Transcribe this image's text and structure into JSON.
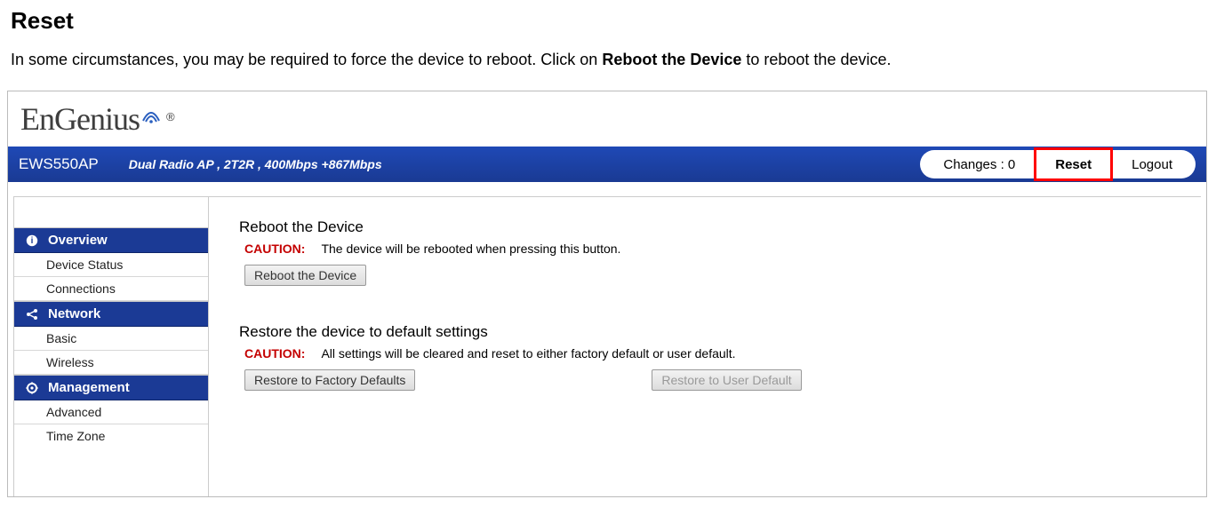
{
  "page": {
    "title": "Reset",
    "description_pre": "In some circumstances, you may be required to force the device to reboot. Click on ",
    "description_bold": "Reboot the Device",
    "description_post": " to reboot the device."
  },
  "logo": {
    "text": "EnGenius",
    "reg": "®"
  },
  "topbar": {
    "model": "EWS550AP",
    "radio_info": "Dual Radio AP , 2T2R , 400Mbps +867Mbps",
    "changes_label": "Changes : 0",
    "reset_label": "Reset",
    "logout_label": "Logout"
  },
  "sidebar": {
    "overview": "Overview",
    "device_status": "Device Status",
    "connections": "Connections",
    "network": "Network",
    "basic": "Basic",
    "wireless": "Wireless",
    "management": "Management",
    "advanced": "Advanced",
    "time_zone": "Time Zone"
  },
  "content": {
    "reboot_title": "Reboot the Device",
    "caution_label": "CAUTION:",
    "reboot_caution": "The device will be rebooted when pressing this button.",
    "reboot_button": "Reboot the Device",
    "restore_title": "Restore the device to default settings",
    "restore_caution": "All settings will be cleared and reset to either factory default or user default.",
    "restore_factory_button": "Restore to Factory Defaults",
    "restore_user_button": "Restore to User Default"
  }
}
